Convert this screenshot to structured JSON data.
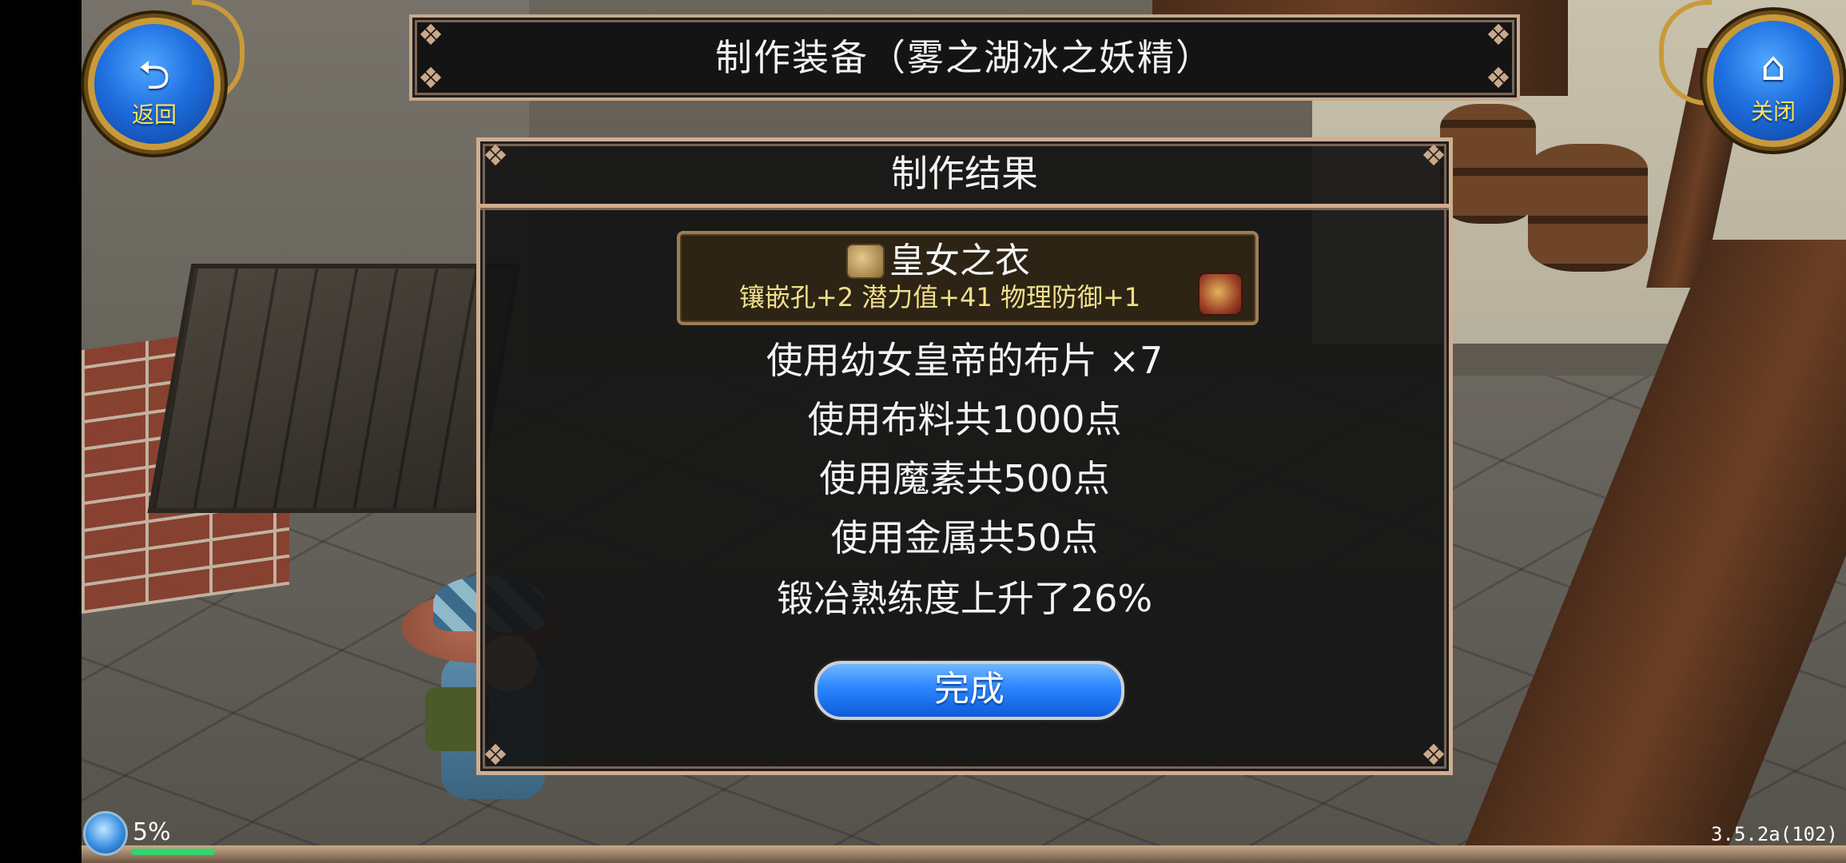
{
  "header": {
    "title": "制作装备（雾之湖冰之妖精）"
  },
  "buttons": {
    "back": {
      "icon": "back-arrow-icon",
      "label": "返回"
    },
    "close": {
      "icon": "home-icon",
      "label": "关闭"
    }
  },
  "dialog": {
    "title": "制作结果",
    "item": {
      "name": "皇女之衣",
      "stats": "镶嵌孔+2  潜力值+41  物理防御+1",
      "icon": "armor-icon",
      "chest_icon": "treasure-chest-icon"
    },
    "results": [
      "使用幼女皇帝的布片  ×7",
      "使用布料共1000点",
      "使用魔素共500点",
      "使用金属共50点",
      "锻冶熟练度上升了26%"
    ],
    "done_label": "完成"
  },
  "status": {
    "xp_percent": "5%",
    "xp_fraction": 0.05,
    "version": "3.5.2a(102)"
  },
  "colors": {
    "frame_border": "#cfae90",
    "button_blue": "#2b86ff",
    "stats_yellow": "#f1e08a",
    "label_yellow": "#ffe35a"
  }
}
